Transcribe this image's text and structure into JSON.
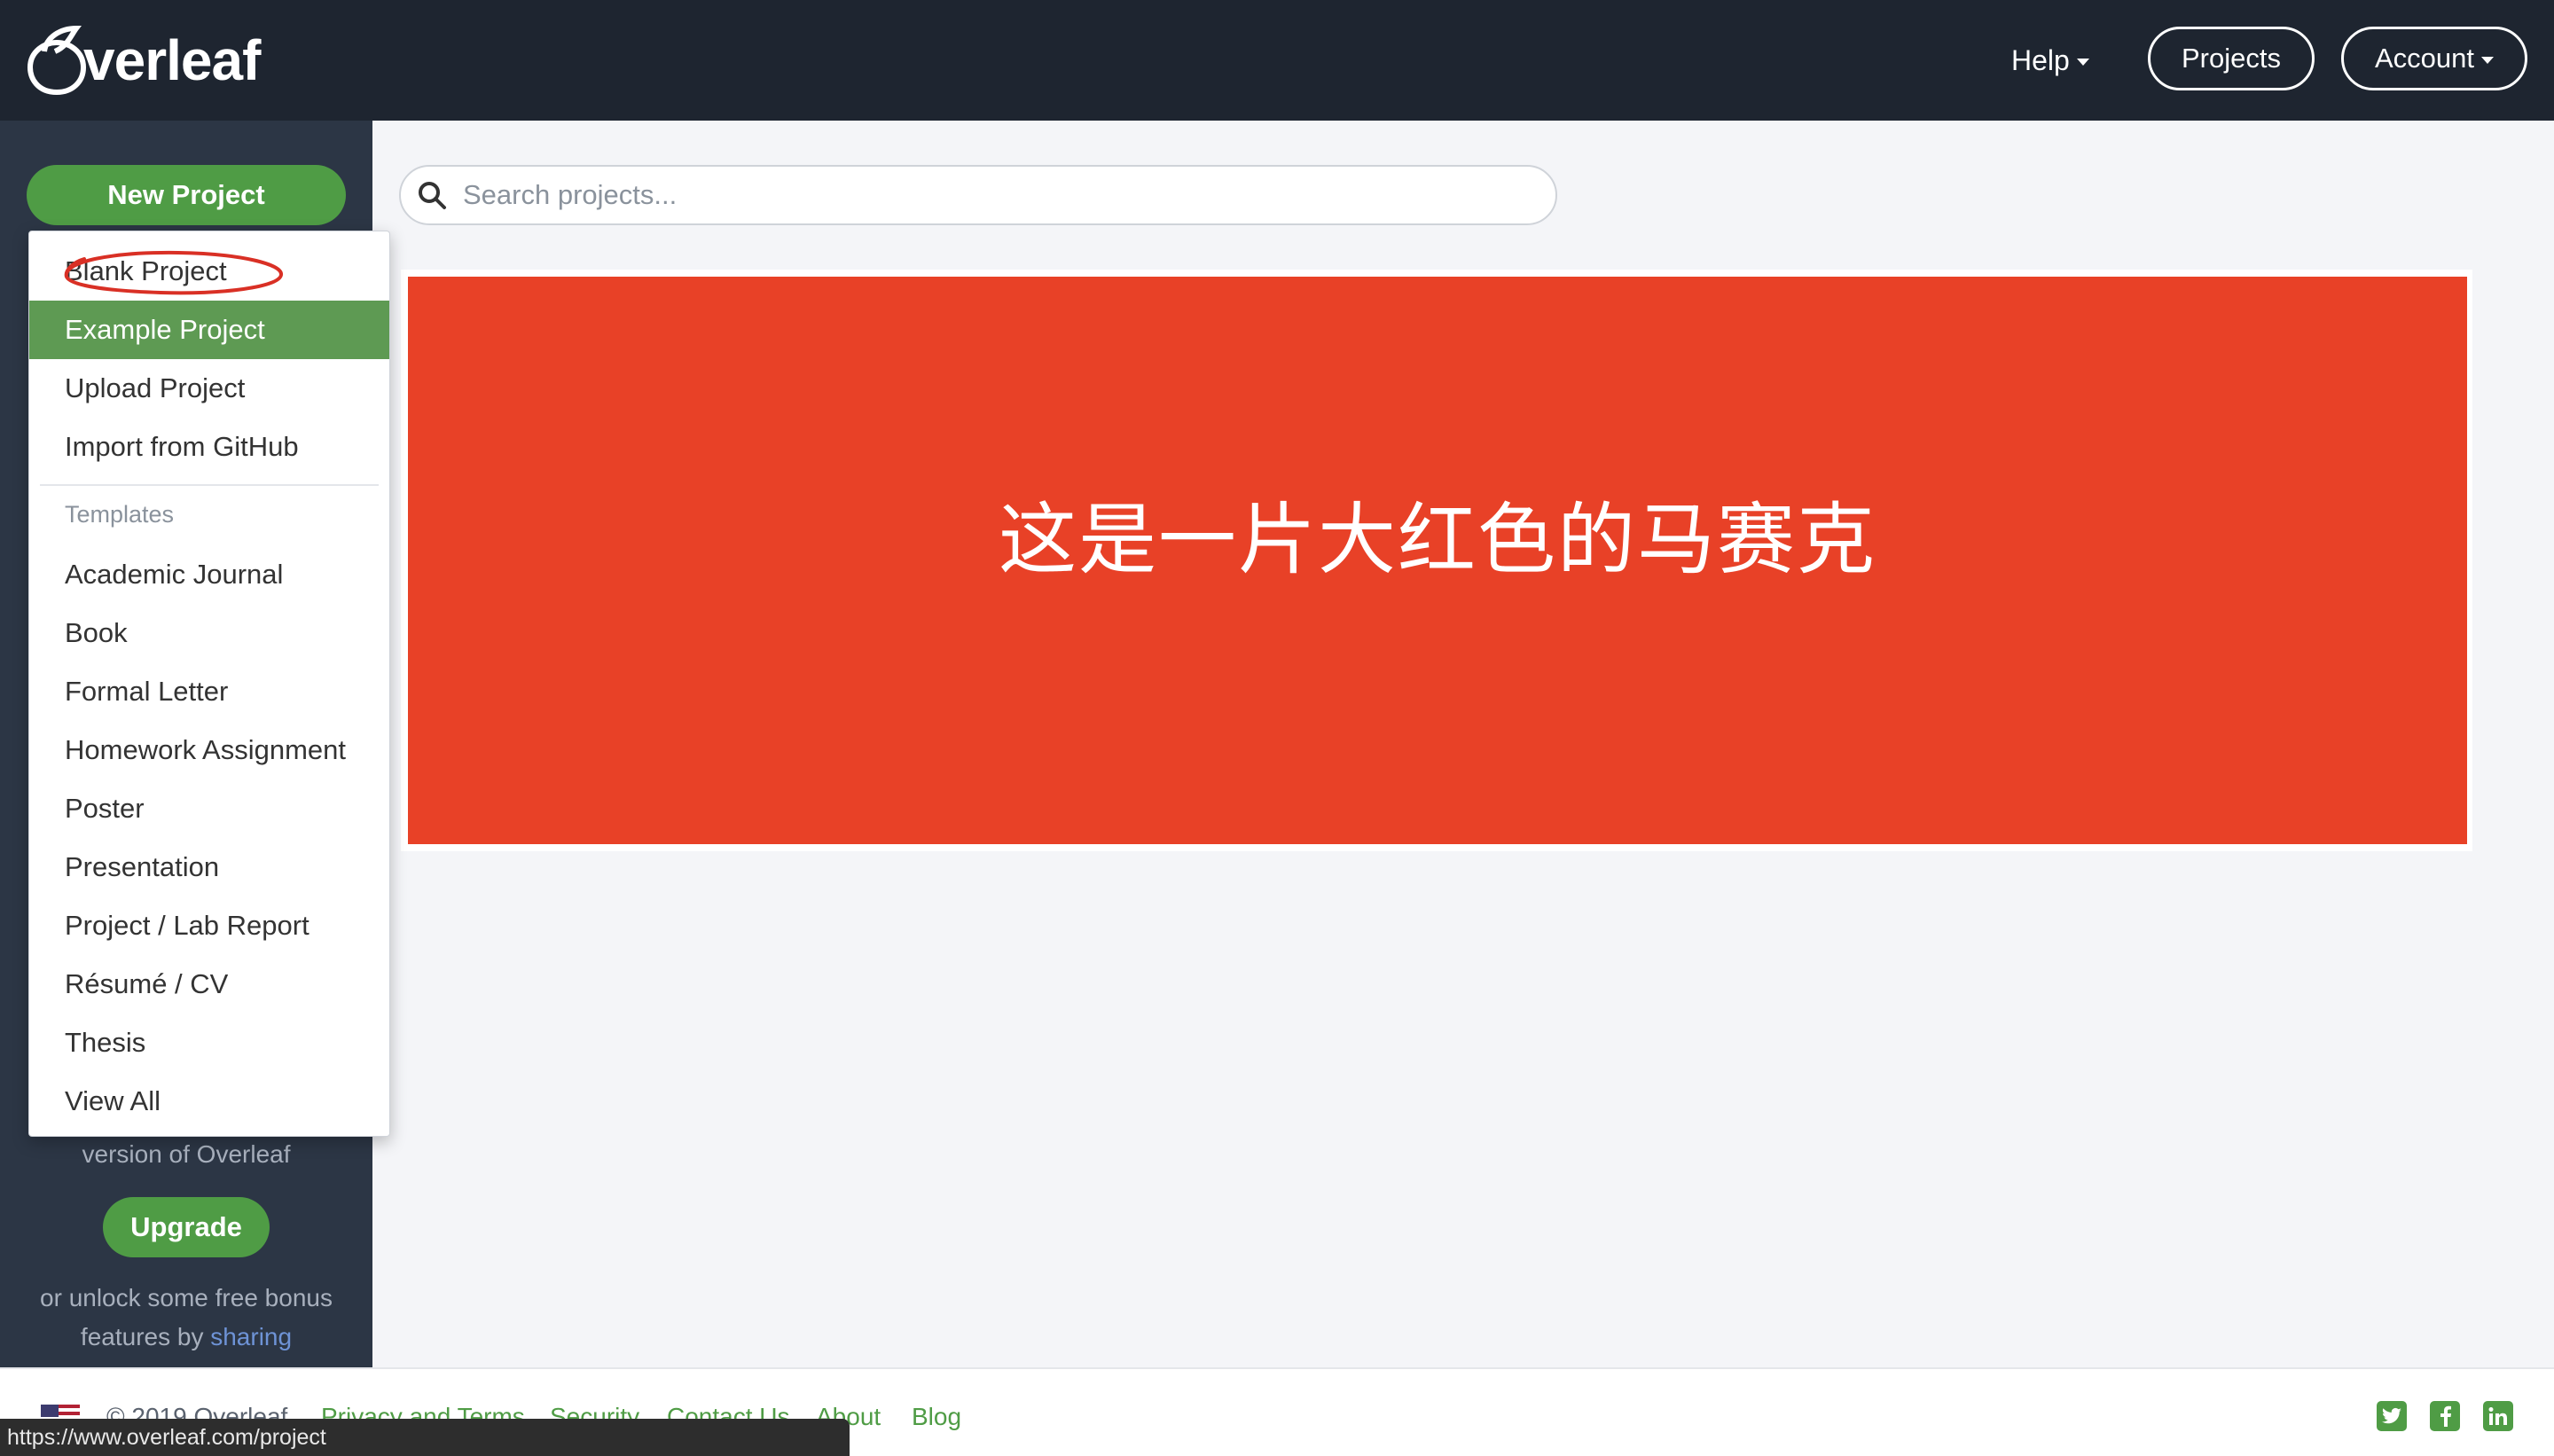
{
  "navbar": {
    "logo_text": "verleaf",
    "help_label": "Help",
    "projects_label": "Projects",
    "account_label": "Account"
  },
  "sidebar": {
    "new_project_label": "New Project",
    "version_text": "version of Overleaf",
    "upgrade_label": "Upgrade",
    "bonus_text_1": "or unlock some free bonus",
    "bonus_text_2_prefix": "features by ",
    "bonus_link": "sharing"
  },
  "dropdown": {
    "items": [
      {
        "label": "Blank Project"
      },
      {
        "label": "Example Project"
      },
      {
        "label": "Upload Project"
      },
      {
        "label": "Import from GitHub"
      }
    ],
    "templates_header": "Templates",
    "templates": [
      {
        "label": "Academic Journal"
      },
      {
        "label": "Book"
      },
      {
        "label": "Formal Letter"
      },
      {
        "label": "Homework Assignment"
      },
      {
        "label": "Poster"
      },
      {
        "label": "Presentation"
      },
      {
        "label": "Project / Lab Report"
      },
      {
        "label": "Résumé / CV"
      },
      {
        "label": "Thesis"
      },
      {
        "label": "View All"
      }
    ],
    "active_item": "Example Project",
    "annotation_color": "#d93025"
  },
  "search": {
    "placeholder": "Search projects..."
  },
  "panel": {
    "text": "这是一片大红色的马赛克",
    "color": "#e84127"
  },
  "footer": {
    "copyright": "© 2019 Overleaf",
    "links": [
      "Privacy and Terms",
      "Security",
      "Contact Us",
      "About",
      "Blog"
    ],
    "social_icons": [
      "twitter-icon",
      "facebook-icon",
      "linkedin-icon"
    ]
  },
  "statusbar": {
    "url": "https://www.overleaf.com/project"
  },
  "colors": {
    "navbar_bg": "#1e2530",
    "sidebar_bg": "#2c3645",
    "accent_green": "#4f9c45"
  }
}
